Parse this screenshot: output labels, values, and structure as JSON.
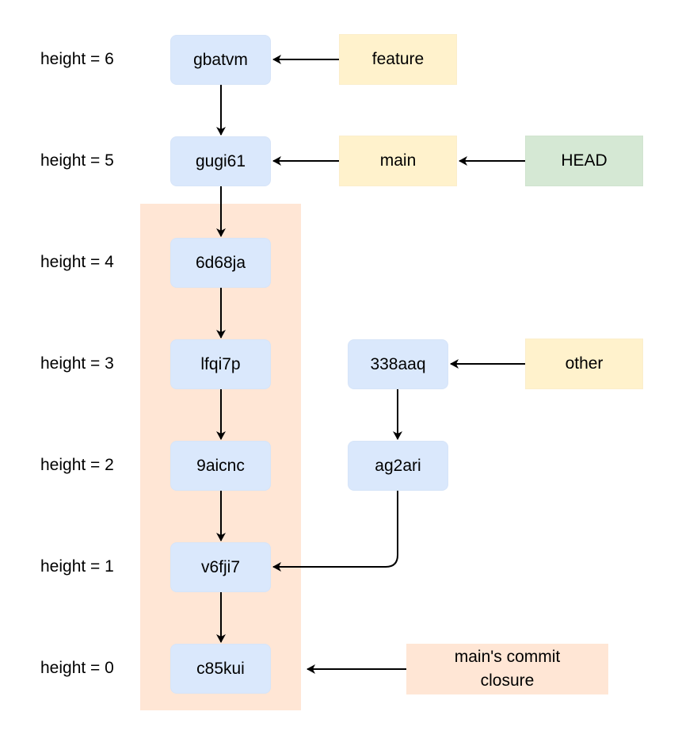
{
  "diagram": {
    "height_labels": [
      "height = 6",
      "height = 5",
      "height = 4",
      "height = 3",
      "height = 2",
      "height = 1",
      "height = 0"
    ],
    "commits": {
      "gbatvm": "gbatvm",
      "gugi61": "gugi61",
      "6d68ja": "6d68ja",
      "lfqi7p": "lfqi7p",
      "9aicnc": "9aicnc",
      "v6fji7": "v6fji7",
      "c85kui": "c85kui",
      "338aaq": "338aaq",
      "ag2ari": "ag2ari"
    },
    "refs": {
      "feature": "feature",
      "main": "main",
      "head": "HEAD",
      "other": "other"
    },
    "closure_label": "main's commit closure",
    "edges": [
      {
        "from": "gbatvm",
        "to": "gugi61"
      },
      {
        "from": "gugi61",
        "to": "6d68ja"
      },
      {
        "from": "6d68ja",
        "to": "lfqi7p"
      },
      {
        "from": "lfqi7p",
        "to": "9aicnc"
      },
      {
        "from": "9aicnc",
        "to": "v6fji7"
      },
      {
        "from": "v6fji7",
        "to": "c85kui"
      },
      {
        "from": "338aaq",
        "to": "ag2ari"
      },
      {
        "from": "ag2ari",
        "to": "v6fji7"
      },
      {
        "from": "feature",
        "to": "gbatvm"
      },
      {
        "from": "main",
        "to": "gugi61"
      },
      {
        "from": "HEAD",
        "to": "main"
      },
      {
        "from": "other",
        "to": "338aaq"
      },
      {
        "from": "main's commit closure",
        "to": "closure"
      }
    ],
    "colors": {
      "commit_fill": "#dae8fc",
      "branch_fill": "#fff2cc",
      "head_fill": "#d5e8d4",
      "closure_fill": "#ffe6d5",
      "edge": "#000000"
    }
  }
}
